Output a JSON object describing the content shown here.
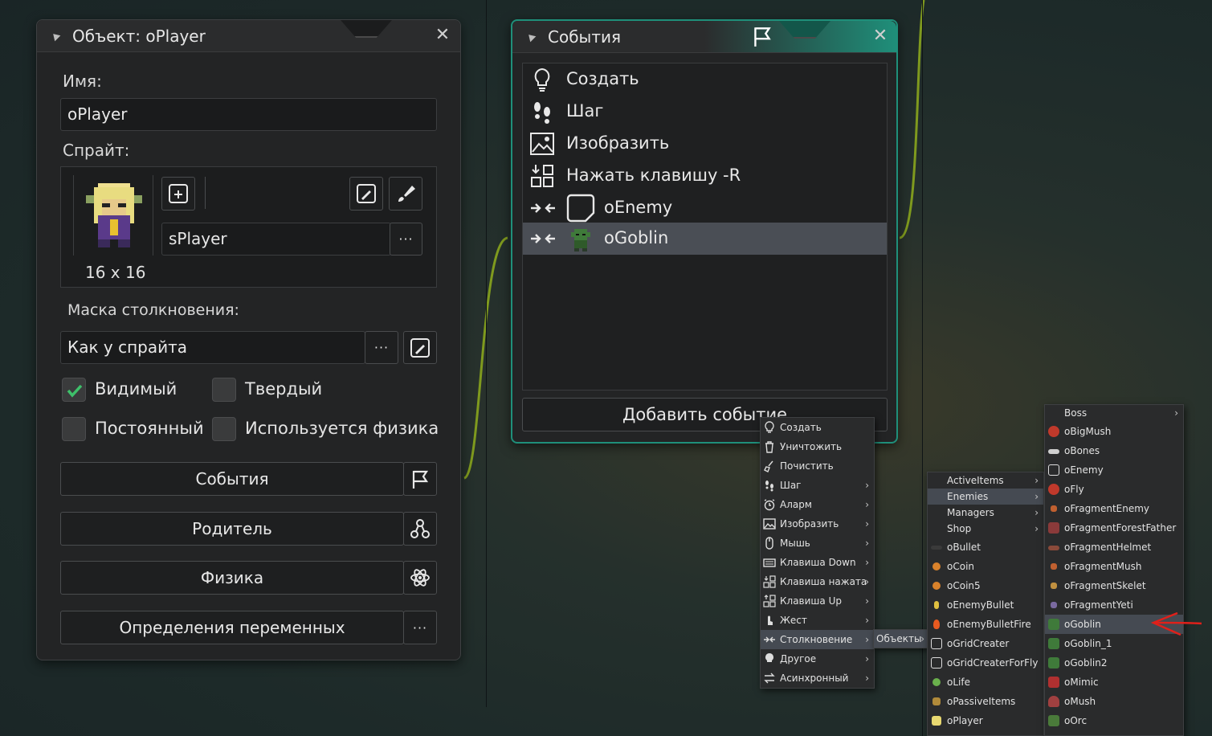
{
  "object_panel": {
    "title": "Объект: oPlayer",
    "name_label": "Имя:",
    "name_value": "oPlayer",
    "sprite_label": "Спрайт:",
    "sprite_value": "sPlayer",
    "sprite_size": "16 x 16",
    "mask_label": "Маска столкновения:",
    "mask_value": "Как у спрайта",
    "dots": "···",
    "visible_label": "Видимый",
    "solid_label": "Твердый",
    "persistent_label": "Постоянный",
    "physics_label": "Используется физика",
    "visible_checked": true,
    "solid_checked": false,
    "persistent_checked": false,
    "physics_checked": false,
    "events_button": "События",
    "parent_button": "Родитель",
    "physics_button": "Физика",
    "variables_button": "Определения переменных"
  },
  "events_panel": {
    "title": "События",
    "events": [
      {
        "label": "Создать",
        "icon": "bulb-icon"
      },
      {
        "label": "Шаг",
        "icon": "footsteps-icon"
      },
      {
        "label": "Изобразить",
        "icon": "picture-icon"
      },
      {
        "label": "Нажать клавишу -R",
        "icon": "keypress-icon"
      },
      {
        "label": "oEnemy",
        "icon": "collision-icon"
      },
      {
        "label": "oGoblin",
        "icon": "collision-icon",
        "selected": true
      }
    ],
    "add_event_button": "Добавить событие"
  },
  "event_menu": [
    {
      "label": "Создать",
      "icon": "bulb-icon",
      "submenu": false
    },
    {
      "label": "Уничтожить",
      "icon": "trash-icon",
      "submenu": false
    },
    {
      "label": "Почистить",
      "icon": "broom-icon",
      "submenu": false
    },
    {
      "label": "Шаг",
      "icon": "footsteps-icon",
      "submenu": true
    },
    {
      "label": "Аларм",
      "icon": "alarm-icon",
      "submenu": true
    },
    {
      "label": "Изобразить",
      "icon": "picture-icon",
      "submenu": true
    },
    {
      "label": "Мышь",
      "icon": "mouse-icon",
      "submenu": true
    },
    {
      "label": "Клавиша Down",
      "icon": "keyboard-icon",
      "submenu": true
    },
    {
      "label": "Клавиша нажата",
      "icon": "keypress-icon",
      "submenu": true
    },
    {
      "label": "Клавиша Up",
      "icon": "keyup-icon",
      "submenu": true
    },
    {
      "label": "Жест",
      "icon": "gesture-icon",
      "submenu": true
    },
    {
      "label": "Столкновение",
      "icon": "collision-icon",
      "submenu": true,
      "highlighted": true
    },
    {
      "label": "Другое",
      "icon": "bulb-icon",
      "submenu": true
    },
    {
      "label": "Асинхронный",
      "icon": "async-icon",
      "submenu": true
    }
  ],
  "objects_menu": {
    "label": "Объекты"
  },
  "folders_menu": [
    {
      "label": "ActiveItems",
      "submenu": true
    },
    {
      "label": "Enemies",
      "submenu": true,
      "highlighted": true
    },
    {
      "label": "Managers",
      "submenu": true
    },
    {
      "label": "Shop",
      "submenu": true
    },
    {
      "label": "oBullet",
      "color": "#3a3a3a"
    },
    {
      "label": "oCoin",
      "color": "#d9822b"
    },
    {
      "label": "oCoin5",
      "color": "#d9822b"
    },
    {
      "label": "oEnemyBullet",
      "color": "#e0c040"
    },
    {
      "label": "oEnemyBulletFire",
      "color": "#e85a20"
    },
    {
      "label": "oGridCreater",
      "color": "none"
    },
    {
      "label": "oGridCreaterForFly",
      "color": "none"
    },
    {
      "label": "oLife",
      "color": "#6ab04c"
    },
    {
      "label": "oPassiveItems",
      "color": "#b08a3a"
    },
    {
      "label": "oPlayer",
      "color": "#e8d870"
    }
  ],
  "enemies_menu": [
    {
      "label": "Boss",
      "submenu": true
    },
    {
      "label": "oBigMush",
      "color": "#c0392b"
    },
    {
      "label": "oBones",
      "color": "#cfcfcf"
    },
    {
      "label": "oEnemy",
      "color": "none"
    },
    {
      "label": "oFly",
      "color": "#c0392b"
    },
    {
      "label": "oFragmentEnemy",
      "color": "#c06030"
    },
    {
      "label": "oFragmentForestFather",
      "color": "#8a3a3a"
    },
    {
      "label": "oFragmentHelmet",
      "color": "#8a4a3a"
    },
    {
      "label": "oFragmentMush",
      "color": "#c06030"
    },
    {
      "label": "oFragmentSkelet",
      "color": "#c09040"
    },
    {
      "label": "oFragmentYeti",
      "color": "#7a6aa0"
    },
    {
      "label": "oGoblin",
      "color": "#3f7a3a",
      "highlighted": true
    },
    {
      "label": "oGoblin_1",
      "color": "#3f7a3a"
    },
    {
      "label": "oGoblin2",
      "color": "#3f7a3a"
    },
    {
      "label": "oMimic",
      "color": "#b03030"
    },
    {
      "label": "oMush",
      "color": "#a04040"
    },
    {
      "label": "oOrc",
      "color": "#4a7a3a"
    }
  ],
  "colors": {
    "accent_teal": "#1f8f7a",
    "arrow_red": "#e0201a",
    "wire_green": "#7f9a1e"
  }
}
